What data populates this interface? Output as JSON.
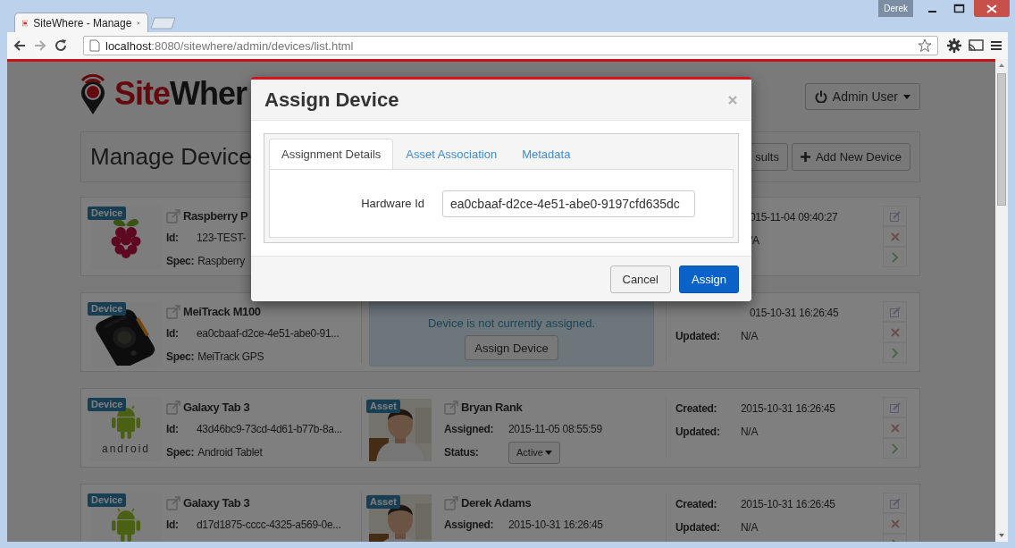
{
  "browser": {
    "tabs": [
      {
        "title": "SiteWhere - Manage",
        "selected": true
      }
    ],
    "profile": "Derek",
    "address": {
      "host": "localhost",
      "path": ":8080/sitewhere/admin/devices/list.html"
    }
  },
  "page": {
    "logo": {
      "accent": "Site",
      "rest": "Wher"
    },
    "user_menu": "Admin User",
    "header": {
      "title": "Manage Device",
      "buttons": [
        {
          "label": "sults",
          "kind": "plain"
        },
        {
          "label": "Add New Device",
          "kind": "add"
        }
      ]
    },
    "devices": [
      {
        "badge": "Device",
        "kind": "raspberry",
        "name": "Raspberry P",
        "fields": [
          {
            "label": "Id:",
            "value": "123-TEST-"
          },
          {
            "label": "Spec:",
            "value": "Raspberry"
          }
        ],
        "dates": [
          {
            "value": "015-11-04 09:40:27"
          },
          {
            "value": "/A"
          }
        ]
      },
      {
        "badge": "Device",
        "name": "MeiTrack M100",
        "fields": [
          {
            "label": "Id:",
            "value": "ea0cbaaf-d2ce-4e51-abe0-91..."
          },
          {
            "label": "Spec:",
            "value": "MeiTrack GPS"
          }
        ],
        "assignment": {
          "kind": "unassigned",
          "message": "Device is not currently assigned.",
          "button": "Assign Device"
        },
        "dates": [
          {
            "value": "015-10-31 16:26:45"
          },
          {
            "label": "Updated:",
            "value": "N/A"
          }
        ]
      },
      {
        "badge": "Device",
        "kind": "android",
        "caption": "android",
        "name": "Galaxy Tab 3",
        "fields": [
          {
            "label": "Id:",
            "value": "43d46bc9-73cd-4d61-b77b-8a..."
          },
          {
            "label": "Spec:",
            "value": "Android Tablet"
          }
        ],
        "assignment": {
          "kind": "asset",
          "badge": "Asset",
          "name": "Bryan Rank",
          "fields": [
            {
              "label": "Assigned:",
              "value": "2015-11-05 08:55:59"
            },
            {
              "label": "Status:",
              "status": "Active"
            }
          ]
        },
        "dates": [
          {
            "label": "Created:",
            "value": "2015-10-31 16:26:45"
          },
          {
            "label": "Updated:",
            "value": "N/A"
          }
        ]
      },
      {
        "badge": "Device",
        "kind": "android",
        "name": "Galaxy Tab 3",
        "fields": [
          {
            "label": "Id:",
            "value": "d17d1875-cccc-4325-a569-0e..."
          }
        ],
        "assignment": {
          "kind": "asset",
          "badge": "Asset",
          "name": "Derek Adams",
          "fields": [
            {
              "label": "Assigned:",
              "value": "2015-10-31 16:26:45"
            }
          ]
        },
        "dates": [
          {
            "label": "Created:",
            "value": "2015-10-31 16:26:45"
          },
          {
            "label": "Updated:",
            "value": "N/A"
          }
        ]
      }
    ]
  },
  "dialog": {
    "title": "Assign Device",
    "tabs": [
      {
        "label": "Assignment Details",
        "selected": true
      },
      {
        "label": "Asset Association",
        "selected": false
      },
      {
        "label": "Metadata",
        "selected": false
      }
    ],
    "fields": [
      {
        "label": "Hardware Id",
        "value": "ea0cbaaf-d2ce-4e51-abe0-9197cfd635dc"
      }
    ],
    "buttons": [
      {
        "label": "Cancel",
        "kind": "default"
      },
      {
        "label": "Assign",
        "kind": "primary"
      }
    ]
  }
}
